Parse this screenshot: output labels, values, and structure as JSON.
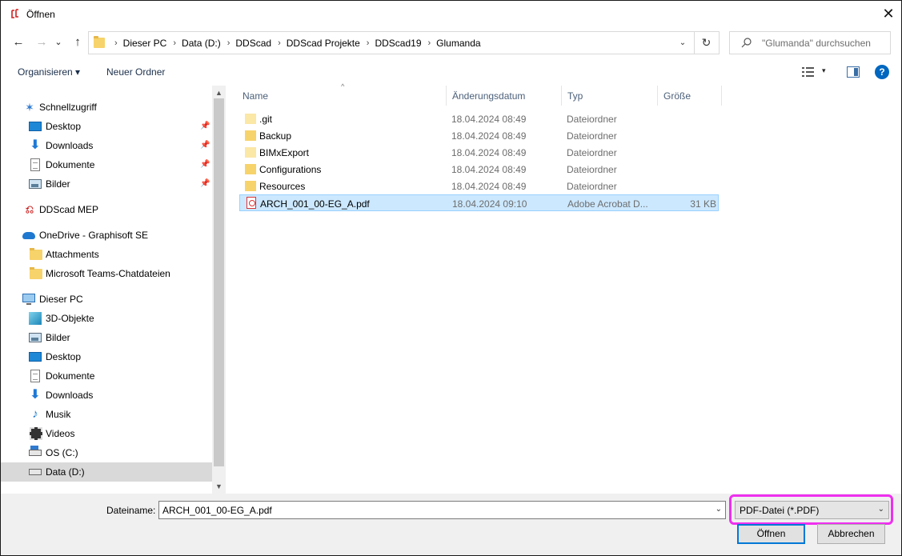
{
  "window": {
    "title": "Öffnen",
    "close_glyph": "✕",
    "app_icon": "ddscad-app-icon"
  },
  "nav": {
    "back_glyph": "←",
    "forward_glyph": "→",
    "recent_glyph": "⌄",
    "up_glyph": "↑",
    "breadcrumb": [
      "Dieser PC",
      "Data (D:)",
      "DDScad",
      "DDScad Projekte",
      "DDScad19",
      "Glumanda"
    ],
    "separator": "›",
    "dropdown_glyph": "⌄",
    "refresh_glyph": "↻",
    "search_placeholder": "\"Glumanda\" durchsuchen"
  },
  "toolbar": {
    "organize": "Organisieren ▾",
    "new_folder": "Neuer Ordner",
    "view_dd_glyph": "▾",
    "help_glyph": "?"
  },
  "sidebar": {
    "items": [
      {
        "label": "Schnellzugriff",
        "icon": "star",
        "pin": ""
      },
      {
        "label": "Desktop",
        "icon": "desktop",
        "pin": "📌"
      },
      {
        "label": "Downloads",
        "icon": "download",
        "pin": "📌"
      },
      {
        "label": "Dokumente",
        "icon": "document",
        "pin": "📌"
      },
      {
        "label": "Bilder",
        "icon": "pictures",
        "pin": "📌"
      },
      {
        "label": "DDScad MEP",
        "icon": "ddscad",
        "pin": ""
      },
      {
        "label": "OneDrive - Graphisoft SE",
        "icon": "cloud",
        "pin": ""
      },
      {
        "label": "Attachments",
        "icon": "folder",
        "pin": ""
      },
      {
        "label": "Microsoft Teams-Chatdateien",
        "icon": "folder",
        "pin": ""
      },
      {
        "label": "Dieser PC",
        "icon": "computer",
        "pin": ""
      },
      {
        "label": "3D-Objekte",
        "icon": "3d-objects",
        "pin": ""
      },
      {
        "label": "Bilder",
        "icon": "pictures",
        "pin": ""
      },
      {
        "label": "Desktop",
        "icon": "desktop",
        "pin": ""
      },
      {
        "label": "Dokumente",
        "icon": "document",
        "pin": ""
      },
      {
        "label": "Downloads",
        "icon": "download",
        "pin": ""
      },
      {
        "label": "Musik",
        "icon": "music",
        "pin": ""
      },
      {
        "label": "Videos",
        "icon": "video",
        "pin": ""
      },
      {
        "label": "OS (C:)",
        "icon": "drive-c",
        "pin": ""
      },
      {
        "label": "Data (D:)",
        "icon": "drive",
        "pin": ""
      }
    ],
    "star_glyph": "✶",
    "download_glyph": "⬇",
    "music_glyph": "♪",
    "ddscad_glyph": "⎌",
    "scroll_up": "▲",
    "scroll_down": "▼"
  },
  "files": {
    "columns": [
      "Name",
      "Änderungsdatum",
      "Typ",
      "Größe"
    ],
    "sort_glyph": "^",
    "rows": [
      {
        "name": ".git",
        "date": "18.04.2024 08:49",
        "type": "Dateiordner",
        "size": "",
        "icon": "folder-hidden"
      },
      {
        "name": "Backup",
        "date": "18.04.2024 08:49",
        "type": "Dateiordner",
        "size": "",
        "icon": "folder"
      },
      {
        "name": "BIMxExport",
        "date": "18.04.2024 08:49",
        "type": "Dateiordner",
        "size": "",
        "icon": "folder-hidden"
      },
      {
        "name": "Configurations",
        "date": "18.04.2024 08:49",
        "type": "Dateiordner",
        "size": "",
        "icon": "folder"
      },
      {
        "name": "Resources",
        "date": "18.04.2024 08:49",
        "type": "Dateiordner",
        "size": "",
        "icon": "folder"
      },
      {
        "name": "ARCH_001_00-EG_A.pdf",
        "date": "18.04.2024 09:10",
        "type": "Adobe Acrobat D...",
        "size": "31 KB",
        "icon": "pdf"
      }
    ]
  },
  "bottom": {
    "filename_label": "Dateiname:",
    "filename_value": "ARCH_001_00-EG_A.pdf",
    "filter_value": "PDF-Datei (*.PDF)",
    "dropdown_glyph": "⌄",
    "open_button": "Öffnen",
    "cancel_button": "Abbrechen"
  }
}
